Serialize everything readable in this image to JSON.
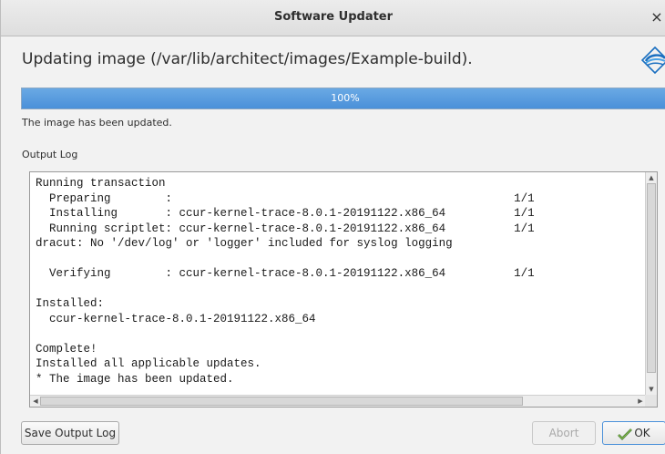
{
  "window": {
    "title": "Software Updater",
    "close_glyph": "×"
  },
  "main": {
    "heading": "Updating image (/var/lib/architect/images/Example-build).",
    "progress": {
      "value": 100,
      "label": "100%"
    },
    "status": "The image has been updated.",
    "log_label": "Output Log",
    "log_lines": [
      "Running transaction",
      "  Preparing        :                                                  1/1",
      "  Installing       : ccur-kernel-trace-8.0.1-20191122.x86_64          1/1",
      "  Running scriptlet: ccur-kernel-trace-8.0.1-20191122.x86_64          1/1",
      "dracut: No '/dev/log' or 'logger' included for syslog logging",
      "",
      "  Verifying        : ccur-kernel-trace-8.0.1-20191122.x86_64          1/1",
      "",
      "Installed:",
      "  ccur-kernel-trace-8.0.1-20191122.x86_64",
      "",
      "Complete!",
      "Installed all applicable updates.",
      "* The image has been updated."
    ]
  },
  "buttons": {
    "save_log": "Save Output Log",
    "abort": "Abort",
    "ok": "OK"
  },
  "icons": {
    "logo": "app-logo-icon",
    "ok": "check-icon"
  },
  "colors": {
    "progress_fill": "#4a90d9"
  }
}
